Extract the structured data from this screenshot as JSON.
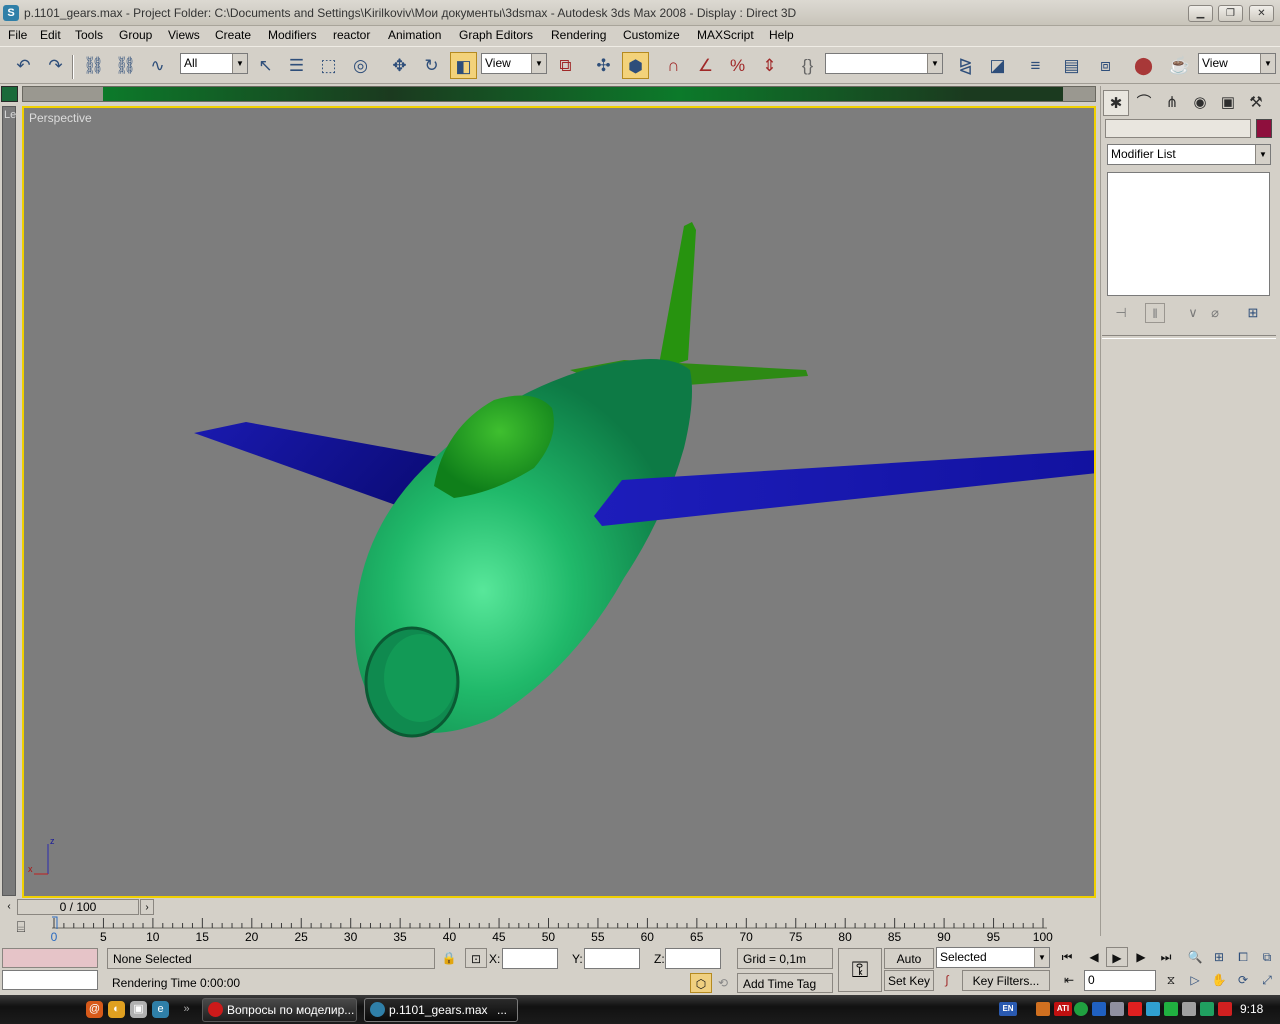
{
  "window": {
    "title": "p.1101_gears.max     - Project Folder: C:\\Documents and Settings\\Kirilkoviv\\Мои документы\\3dsmax      - Autodesk 3ds Max 2008       - Display : Direct 3D"
  },
  "menu": [
    "File",
    "Edit",
    "Tools",
    "Group",
    "Views",
    "Create",
    "Modifiers",
    "reactor",
    "Animation",
    "Graph Editors",
    "Rendering",
    "Customize",
    "MAXScript",
    "Help"
  ],
  "toolbar": {
    "selection_filter": "All",
    "reference_coord": "View",
    "named_selection": "",
    "view_dropdown": "View"
  },
  "viewport": {
    "label": "Perspective",
    "left_strip_label": "Le",
    "axis_z": "z",
    "axis_x": "x"
  },
  "command_panel": {
    "object_name": "",
    "object_color": "#8e0f3d",
    "modifier_list": "Modifier List"
  },
  "timeline": {
    "slider_label": "0 / 100",
    "ticks": [
      "0",
      "5",
      "10",
      "15",
      "20",
      "25",
      "30",
      "35",
      "40",
      "45",
      "50",
      "55",
      "60",
      "65",
      "70",
      "75",
      "80",
      "85",
      "90",
      "95",
      "100"
    ]
  },
  "status": {
    "selection": "None Selected",
    "prompt": "Rendering Time  0:00:00",
    "x_label": "X:",
    "y_label": "Y:",
    "z_label": "Z:",
    "grid": "Grid = 0,1m",
    "add_time_tag": "Add Time Tag",
    "auto_key": "Auto Key",
    "set_key": "Set Key",
    "key_mode": "Selected",
    "key_filters": "Key Filters...",
    "frame": "0"
  },
  "taskbar": {
    "tasks": [
      {
        "label": "Вопросы по моделир...",
        "active": false
      },
      {
        "label": "p.1101_gears.max",
        "active": true
      }
    ],
    "tasks_more": "...",
    "language": "EN",
    "clock": "9:18"
  }
}
